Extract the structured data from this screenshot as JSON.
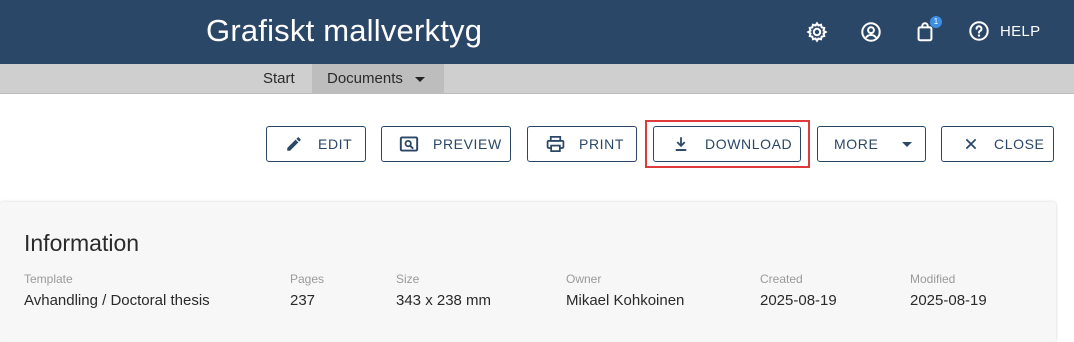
{
  "header": {
    "title": "Grafiskt mallverktyg",
    "cart_count": "1",
    "help_label": "HELP"
  },
  "nav": {
    "start": "Start",
    "documents": "Documents"
  },
  "toolbar": {
    "edit": "EDIT",
    "preview": "PREVIEW",
    "print": "PRINT",
    "download": "DOWNLOAD",
    "more": "MORE",
    "close": "CLOSE"
  },
  "info": {
    "title": "Information",
    "fields": [
      {
        "label": "Template",
        "value": "Avhandling / Doctoral thesis"
      },
      {
        "label": "Pages",
        "value": "237"
      },
      {
        "label": "Size",
        "value": "343 x 238 mm"
      },
      {
        "label": "Owner",
        "value": "Mikael Kohkoinen"
      },
      {
        "label": "Created",
        "value": "2025-08-19"
      },
      {
        "label": "Modified",
        "value": "2025-08-19"
      }
    ]
  },
  "colors": {
    "header_bg": "#2b4767",
    "nav_bg": "#cfcfcf",
    "accent": "#2b4767",
    "highlight": "#e0393b",
    "badge": "#3d8fe6"
  },
  "icons": [
    "gear-icon",
    "account-icon",
    "cart-icon",
    "help-icon",
    "pencil-icon",
    "preview-icon",
    "printer-icon",
    "download-icon",
    "caret-down-icon",
    "close-icon"
  ]
}
